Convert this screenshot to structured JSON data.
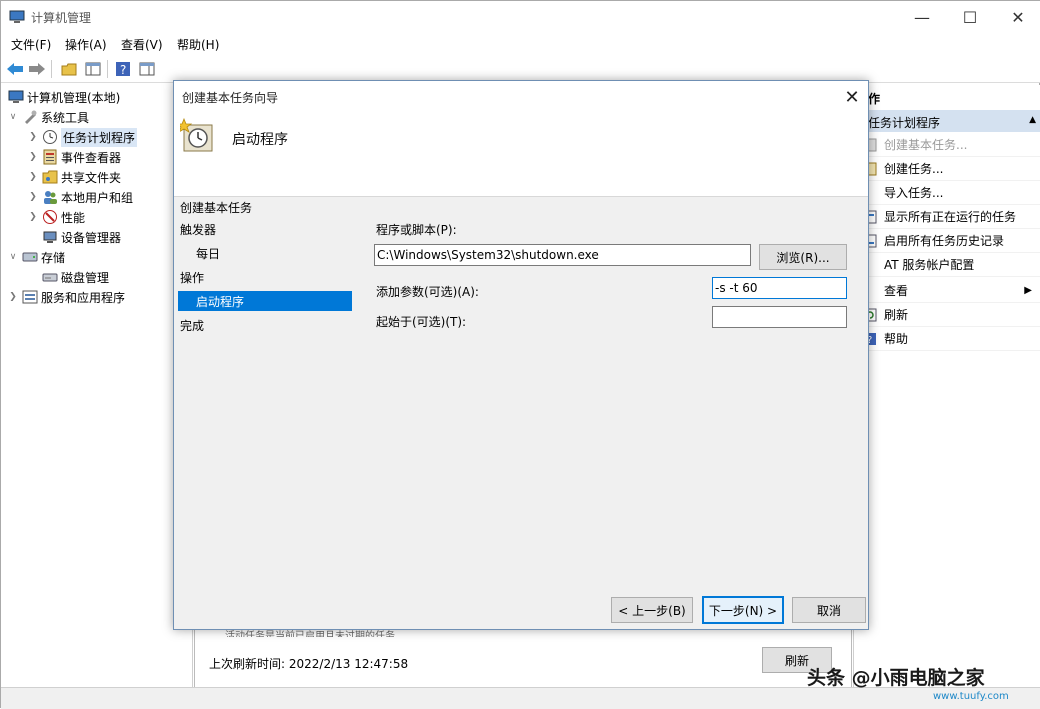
{
  "window": {
    "title": "计算机管理"
  },
  "menu": [
    "文件(F)",
    "操作(A)",
    "查看(V)",
    "帮助(H)"
  ],
  "tree": {
    "root": "计算机管理(本地)",
    "system_tools": "系统工具",
    "task_scheduler": "任务计划程序",
    "event_viewer": "事件查看器",
    "shared_folders": "共享文件夹",
    "local_users": "本地用户和组",
    "performance": "性能",
    "device_manager": "设备管理器",
    "storage": "存储",
    "disk_management": "磁盘管理",
    "services": "服务和应用程序"
  },
  "center": {
    "last_refresh": "上次刷新时间: 2022/2/13 12:47:58",
    "refresh_button": "刷新",
    "partial_text": "活动任务是当前已启用且未过期的任务"
  },
  "actions": {
    "header": "作",
    "section": "任务计划程序",
    "items": [
      {
        "label": "创建基本任务...",
        "disabled": true
      },
      {
        "label": "创建任务...",
        "disabled": false
      },
      {
        "label": "导入任务...",
        "disabled": false
      },
      {
        "label": "显示所有正在运行的任务",
        "disabled": false
      },
      {
        "label": "启用所有任务历史记录",
        "disabled": false
      },
      {
        "label": "AT 服务帐户配置",
        "disabled": false
      },
      {
        "label": "查看",
        "disabled": false
      },
      {
        "label": "刷新",
        "disabled": false
      },
      {
        "label": "帮助",
        "disabled": false
      }
    ]
  },
  "dialog": {
    "title": "创建基本任务向导",
    "heading": "启动程序",
    "steps": {
      "create_basic": "创建基本任务",
      "trigger": "触发器",
      "daily": "每日",
      "action": "操作",
      "start_program": "启动程序",
      "finish": "完成"
    },
    "program_label": "程序或脚本(P):",
    "program_value": "C:\\Windows\\System32\\shutdown.exe",
    "browse_button": "浏览(R)...",
    "args_label": "添加参数(可选)(A):",
    "args_value": "-s -t 60",
    "start_in_label": "起始于(可选)(T):",
    "start_in_value": "",
    "back_button": "< 上一步(B)",
    "next_button": "下一步(N) >",
    "cancel_button": "取消"
  },
  "watermark": {
    "text": "头条 @小雨电脑之家",
    "url": "www.tuufy.com"
  }
}
